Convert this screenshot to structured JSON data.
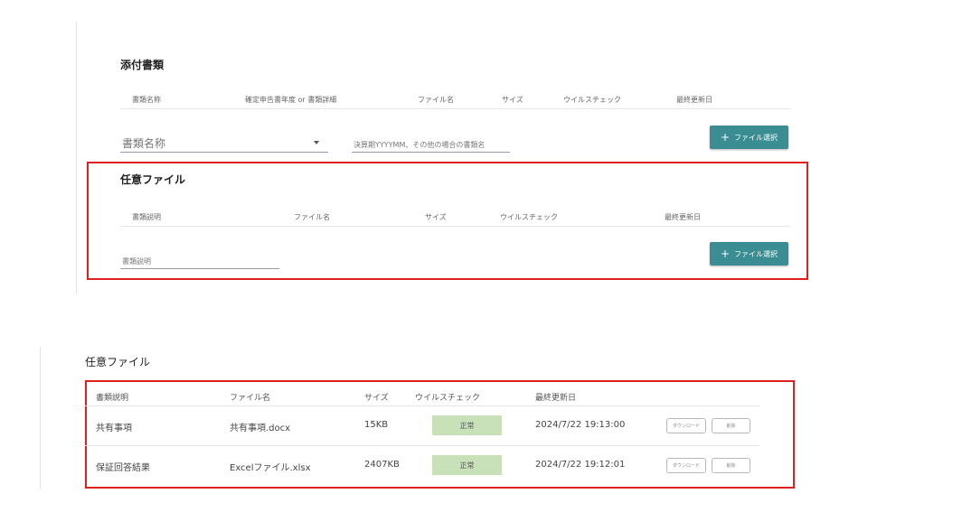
{
  "attachments": {
    "title": "添付書類",
    "columns": [
      "書類名称",
      "確定申告書年度 or 書類詳細",
      "ファイル名",
      "サイズ",
      "ウイルスチェック",
      "最終更新日"
    ],
    "doc_name_select": {
      "value": "書類名称"
    },
    "period_input": {
      "placeholder": "決算期YYYYMM、その他の場合の書類名"
    },
    "file_button_label": "ファイル選択"
  },
  "optional_form": {
    "title": "任意ファイル",
    "columns": [
      "書類説明",
      "ファイル名",
      "サイズ",
      "ウイルスチェック",
      "最終更新日"
    ],
    "desc_input": {
      "placeholder": "書類説明"
    },
    "file_button_label": "ファイル選択"
  },
  "optional_list": {
    "title": "任意ファイル",
    "columns": [
      "書類説明",
      "ファイル名",
      "サイズ",
      "ウイルスチェック",
      "最終更新日"
    ],
    "rows": [
      {
        "description": "共有事項",
        "filename": "共有事項.docx",
        "size": "15KB",
        "status": "正常",
        "updated": "2024/7/22 19:13:00",
        "download_label": "ダウンロード",
        "delete_label": "削除"
      },
      {
        "description": "保証回答結果",
        "filename": "Excelファイル.xlsx",
        "size": "2407KB",
        "status": "正常",
        "updated": "2024/7/22 19:12:01",
        "download_label": "ダウンロード",
        "delete_label": "削除"
      }
    ]
  },
  "colors": {
    "accent": "#3a8e93",
    "highlight": "#e02020",
    "status_ok_bg": "#c8e1b8"
  }
}
